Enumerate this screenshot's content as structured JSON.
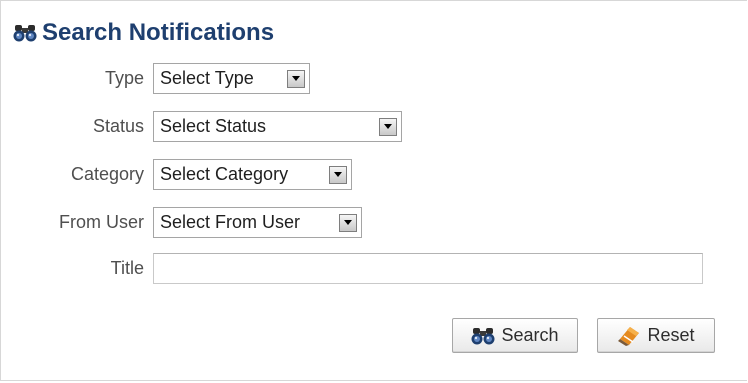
{
  "form": {
    "title": "Search Notifications",
    "title_icon": "binoculars-icon",
    "fields": {
      "type": {
        "label": "Type",
        "value": "Select Type"
      },
      "status": {
        "label": "Status",
        "value": "Select Status"
      },
      "category": {
        "label": "Category",
        "value": "Select Category"
      },
      "from_user": {
        "label": "From User",
        "value": "Select From User"
      },
      "title": {
        "label": "Title",
        "value": ""
      }
    },
    "buttons": {
      "search": {
        "label": "Search",
        "icon": "binoculars-icon"
      },
      "reset": {
        "label": "Reset",
        "icon": "eraser-icon"
      }
    }
  },
  "colors": {
    "title": "#1e3f6f",
    "label": "#4f4f4f",
    "border": "#a5a5a5"
  }
}
